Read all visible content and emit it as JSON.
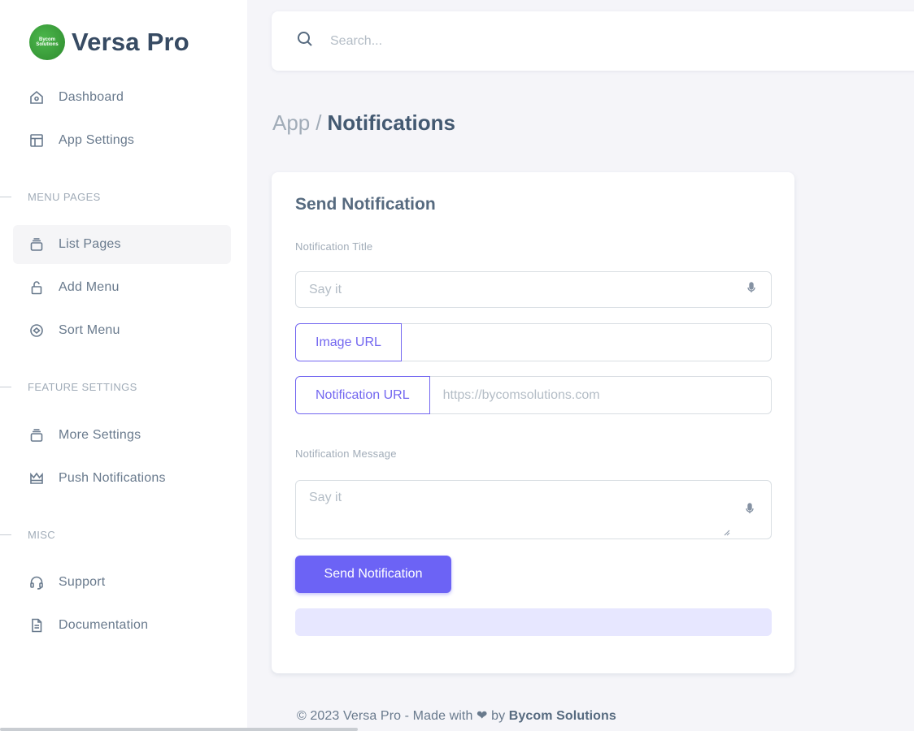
{
  "brand": {
    "name": "Versa Pro",
    "logo_text": "Bycom Solutions"
  },
  "sidebar": {
    "top_items": [
      {
        "label": "Dashboard",
        "icon": "home-icon"
      },
      {
        "label": "App Settings",
        "icon": "layout-icon"
      }
    ],
    "sections": [
      {
        "header": "MENU PAGES",
        "items": [
          {
            "label": "List Pages",
            "icon": "stack-icon",
            "active": true
          },
          {
            "label": "Add Menu",
            "icon": "lock-icon"
          },
          {
            "label": "Sort Menu",
            "icon": "circle-icon"
          }
        ]
      },
      {
        "header": "FEATURE SETTINGS",
        "items": [
          {
            "label": "More Settings",
            "icon": "stack-icon"
          },
          {
            "label": "Push Notifications",
            "icon": "crown-icon"
          }
        ]
      },
      {
        "header": "MISC",
        "items": [
          {
            "label": "Support",
            "icon": "headset-icon"
          },
          {
            "label": "Documentation",
            "icon": "document-icon"
          }
        ]
      }
    ]
  },
  "search": {
    "placeholder": "Search..."
  },
  "breadcrumb": {
    "parent": "App",
    "separator": "/",
    "current": "Notifications"
  },
  "form": {
    "title": "Send Notification",
    "title_label": "Notification Title",
    "title_placeholder": "Say it",
    "image_url_label": "Image URL",
    "image_url_value": "",
    "notification_url_label": "Notification URL",
    "notification_url_placeholder": "https://bycomsolutions.com",
    "message_label": "Notification Message",
    "message_placeholder": "Say it",
    "submit_label": "Send Notification"
  },
  "footer": {
    "prefix": "© 2023 Versa Pro - Made with",
    "heart": "❤",
    "by": "by",
    "company": "Bycom Solutions"
  },
  "colors": {
    "primary": "#6c63f5",
    "outline_primary": "#7367f0",
    "alert_bg": "#e7e7ff",
    "brand_green": "#3aa23a",
    "page_bg": "#f5f5f9"
  }
}
